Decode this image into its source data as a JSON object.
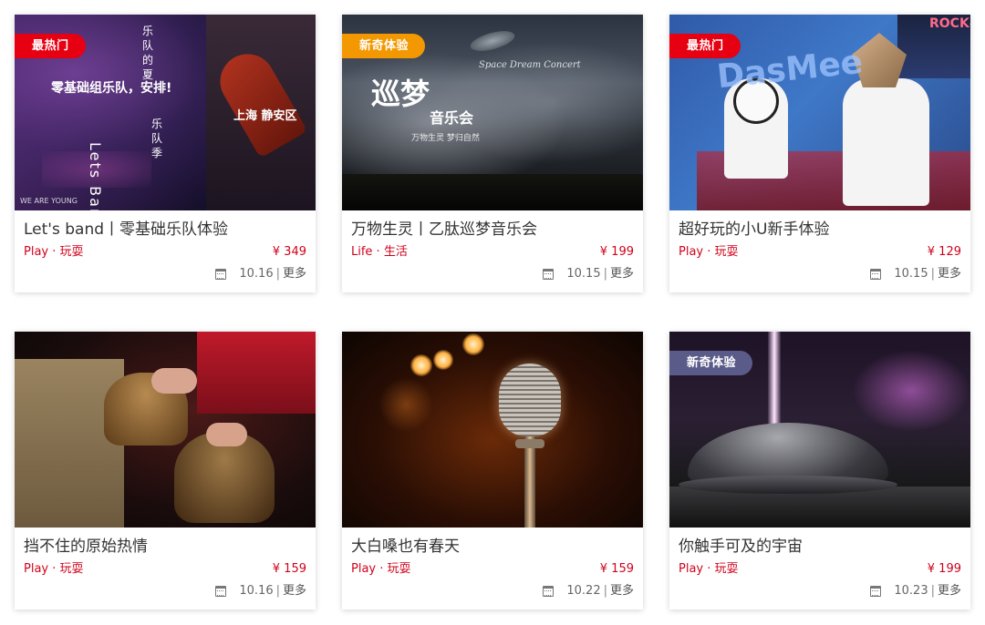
{
  "icons": {
    "calendar": "calendar-icon"
  },
  "colors": {
    "accent": "#d0021b",
    "tag_hot": "#e60012",
    "tag_new": "#f39800",
    "tag_new_dark": "#5b5b8a"
  },
  "cards": [
    {
      "title": "Let's band丨零基础乐队体验",
      "category": "Play · 玩耍",
      "price": "¥ 349",
      "date": "10.16",
      "more": "更多",
      "tag": "最热门",
      "overlay": {
        "line1": "零基础组乐队，安排!",
        "line2": "乐队的夏",
        "line3": "上海 静安区",
        "line4": "Lets Band",
        "line5": "WE ARE YOUNG",
        "line6": "乐队季"
      }
    },
    {
      "title": "万物生灵丨乙肽巡梦音乐会",
      "category": "Life · 生活",
      "price": "¥ 199",
      "date": "10.15",
      "more": "更多",
      "tag": "新奇体验",
      "overlay": {
        "line1": "巡梦",
        "line2": "音乐会",
        "line3": "万物生灵 梦归自然",
        "line4": "Space Dream Concert"
      }
    },
    {
      "title": "超好玩的小U新手体验",
      "category": "Play · 玩耍",
      "price": "¥ 129",
      "date": "10.15",
      "more": "更多",
      "tag": "最热门",
      "overlay": {
        "line1": "DasMee",
        "line2": "ROCK&"
      }
    },
    {
      "title": "挡不住的原始热情",
      "category": "Play · 玩耍",
      "price": "¥ 159",
      "date": "10.16",
      "more": "更多",
      "tag": ""
    },
    {
      "title": "大白嗓也有春天",
      "category": "Play · 玩耍",
      "price": "¥ 159",
      "date": "10.22",
      "more": "更多",
      "tag": ""
    },
    {
      "title": "你触手可及的宇宙",
      "category": "Play · 玩耍",
      "price": "¥ 199",
      "date": "10.23",
      "more": "更多",
      "tag": "新奇体验"
    }
  ]
}
